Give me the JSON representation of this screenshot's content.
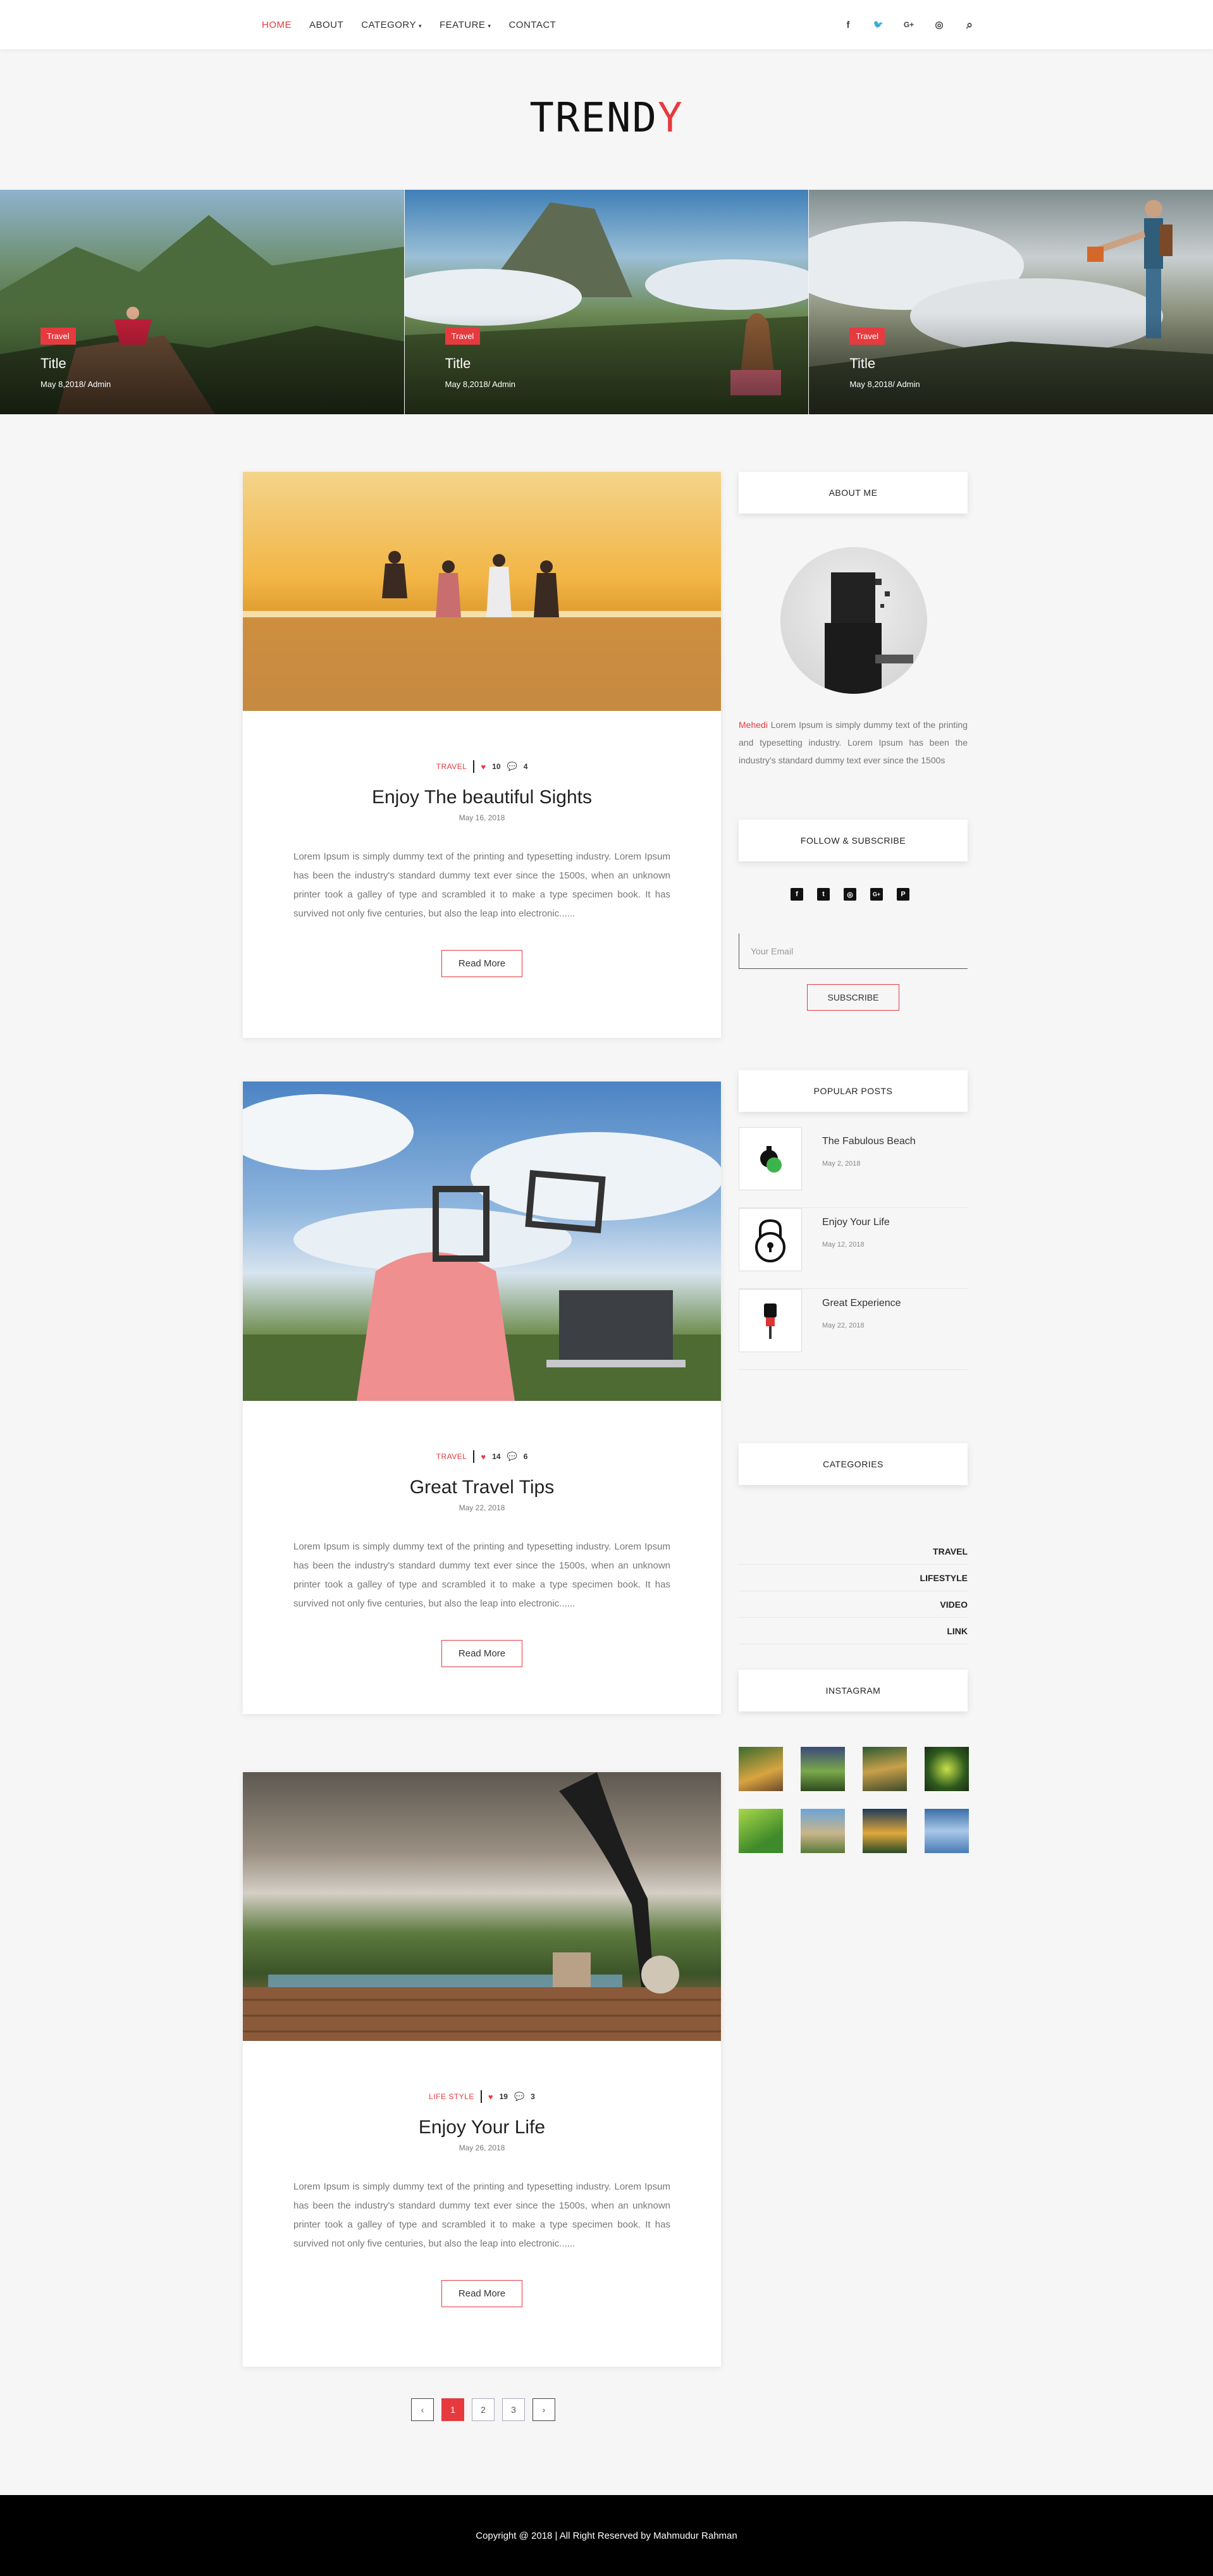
{
  "nav": {
    "links": [
      {
        "label": "HOME",
        "active": true
      },
      {
        "label": "ABOUT"
      },
      {
        "label": "CATEGORY",
        "caret": "▾"
      },
      {
        "label": "FEATURE",
        "caret": "▾"
      },
      {
        "label": "CONTACT"
      }
    ],
    "icons": [
      {
        "name": "facebook-icon",
        "glyph": "f"
      },
      {
        "name": "twitter-icon",
        "glyph": "🐦"
      },
      {
        "name": "google-plus-icon",
        "glyph": "G+"
      },
      {
        "name": "instagram-icon",
        "glyph": "◎"
      },
      {
        "name": "search-icon",
        "glyph": "⌕"
      }
    ]
  },
  "logo": {
    "main": "TREND",
    "accent": "Y"
  },
  "slides": [
    {
      "badge": "Travel",
      "title": "Title",
      "meta": "May 8,2018/ Admin"
    },
    {
      "badge": "Travel",
      "title": "Title",
      "meta": "May 8,2018/ Admin"
    },
    {
      "badge": "Travel",
      "title": "Title",
      "meta": "May 8,2018/ Admin"
    }
  ],
  "posts": [
    {
      "category": "TRAVEL",
      "likes": "10",
      "comments": "4",
      "title": "Enjoy The beautiful Sights",
      "date": "May 16, 2018",
      "excerpt": "Lorem Ipsum is simply dummy text of the printing and typesetting industry. Lorem Ipsum has been the industry's standard dummy text ever since the 1500s, when an unknown printer took a galley of type and scrambled it to make a type specimen book. It has survived not only five centuries, but also the leap into electronic......",
      "button": "Read More"
    },
    {
      "category": "TRAVEL",
      "likes": "14",
      "comments": "6",
      "title": "Great Travel Tips",
      "date": "May 22, 2018",
      "excerpt": "Lorem Ipsum is simply dummy text of the printing and typesetting industry. Lorem Ipsum has been the industry's standard dummy text ever since the 1500s, when an unknown printer took a galley of type and scrambled it to make a type specimen book. It has survived not only five centuries, but also the leap into electronic......",
      "button": "Read More"
    },
    {
      "category": "LIFE STYLE",
      "likes": "19",
      "comments": "3",
      "title": "Enjoy Your Life",
      "date": "May 26, 2018",
      "excerpt": "Lorem Ipsum is simply dummy text of the printing and typesetting industry. Lorem Ipsum has been the industry's standard dummy text ever since the 1500s, when an unknown printer took a galley of type and scrambled it to make a type specimen book. It has survived not only five centuries, but also the leap into electronic......",
      "button": "Read More"
    }
  ],
  "sidebar": {
    "about_title": "ABOUT ME",
    "about_name": "Mehedi",
    "about_text": " Lorem Ipsum is simply dummy text of the printing and typesetting industry. Lorem Ipsum has been the industry's standard dummy text ever since the 1500s",
    "follow_title": "FOLLOW & SUBSCRIBE",
    "social": [
      "f",
      "t",
      "◎",
      "G+",
      "P"
    ],
    "email_placeholder": "Your Email",
    "subscribe_label": "SUBSCRIBE",
    "popular_title": "POPULAR POSTS",
    "popular": [
      {
        "title": "The Fabulous Beach",
        "date": "May 2, 2018"
      },
      {
        "title": "Enjoy Your Life",
        "date": "May 12, 2018"
      },
      {
        "title": "Great Experience",
        "date": "May 22, 2018"
      }
    ],
    "categories_title": "CATEGORIES",
    "categories": [
      "TRAVEL",
      "LIFESTYLE",
      "VIDEO",
      "LINK"
    ],
    "instagram_title": "INSTAGRAM"
  },
  "pagination": {
    "prev": "‹",
    "pages": [
      "1",
      "2",
      "3"
    ],
    "next": "›"
  },
  "footer": {
    "text": "Copyright @ 2018 | All Right Reserved by Mahmudur Rahman"
  },
  "colors": {
    "accent": "#e63a3f",
    "footer_bg": "#000000",
    "page_bg": "#f6f6f6"
  }
}
